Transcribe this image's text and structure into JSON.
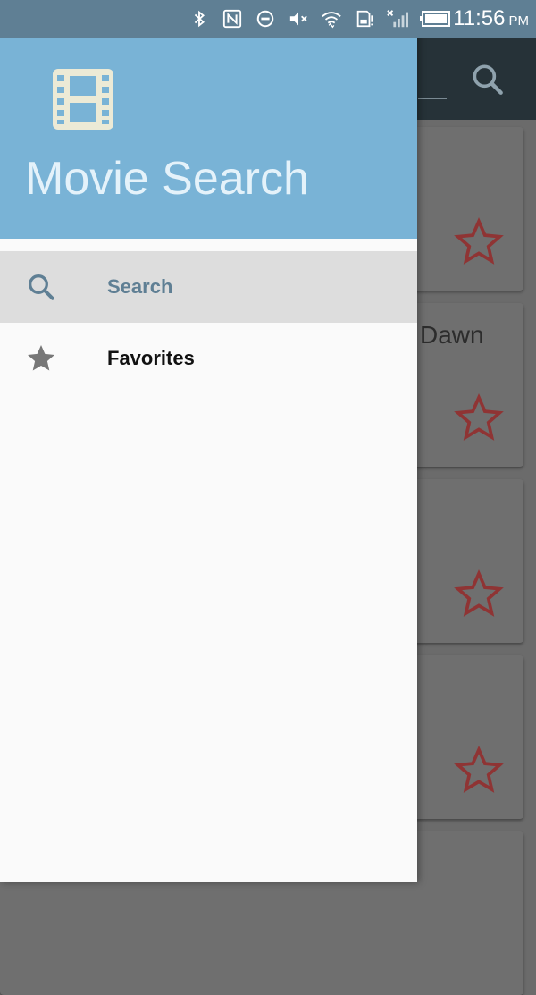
{
  "status_bar": {
    "icons": [
      "bluetooth-icon",
      "nfc-icon",
      "do-not-disturb-icon",
      "volume-muted-icon",
      "wifi-icon",
      "sd-card-alert-icon",
      "no-signal-icon",
      "battery-icon"
    ],
    "time": "11:56",
    "ampm": "PM"
  },
  "drawer": {
    "header_icon": "film-strip-icon",
    "title": "Movie Search",
    "header_color": "#79b3d6",
    "items": [
      {
        "label": "Search",
        "icon": "search-icon",
        "active": true
      },
      {
        "label": "Favorites",
        "icon": "star-icon",
        "active": false
      }
    ]
  },
  "background": {
    "toolbar_icon": "search-icon",
    "partial_card_title": "Dawn",
    "star_color": "#8f3434"
  }
}
